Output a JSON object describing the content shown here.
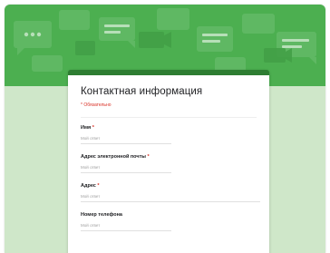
{
  "form": {
    "title": "Контактная информация",
    "required_note": "* Обязательно",
    "fields": [
      {
        "label": "Имя",
        "required": true,
        "placeholder": "Мой ответ"
      },
      {
        "label": "Адрес электронной почты",
        "required": true,
        "placeholder": "Мой ответ"
      },
      {
        "label": "Адрес",
        "required": true,
        "placeholder": "Мой ответ"
      },
      {
        "label": "Номер телефона",
        "required": false,
        "placeholder": "Мой ответ"
      }
    ]
  },
  "colors": {
    "banner": "#4caf50",
    "background": "#cfe7c9",
    "card_accent": "#2e7d32",
    "required": "#d93025"
  }
}
